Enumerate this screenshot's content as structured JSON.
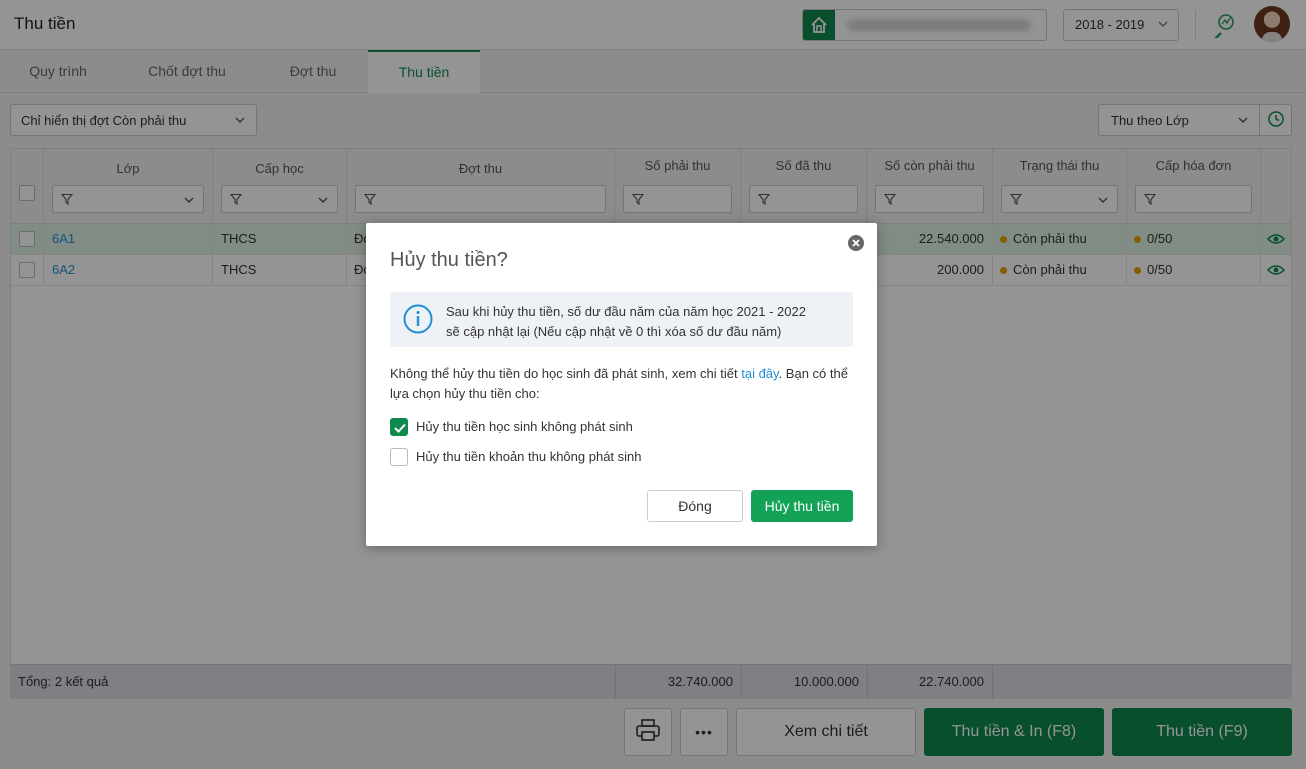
{
  "header": {
    "title": "Thu tiền",
    "school_name": "Trường THCS Hoàng Hoa Thám",
    "school_year": "2018 - 2019"
  },
  "tabs": [
    {
      "label": "Quy trình",
      "active": false
    },
    {
      "label": "Chốt đợt thu",
      "active": false
    },
    {
      "label": "Đợt thu",
      "active": false
    },
    {
      "label": "Thu tiền",
      "active": true
    }
  ],
  "toolbar": {
    "filter_value": "Chỉ hiển thị đợt Còn phải thu",
    "group_by_value": "Thu theo Lớp"
  },
  "table": {
    "columns": [
      "Lớp",
      "Cấp học",
      "Đợt thu",
      "Số phải thu",
      "Số đã thu",
      "Số còn phải thu",
      "Trạng thái thu",
      "Cấp hóa đơn"
    ],
    "rows": [
      {
        "class": "6A1",
        "level": "THCS",
        "batch": "Đợ",
        "due": "",
        "paid": "",
        "remaining": "22.540.000",
        "status": "Còn phải thu",
        "invoice": "0/50"
      },
      {
        "class": "6A2",
        "level": "THCS",
        "batch": "Đợ",
        "due": "",
        "paid": "",
        "remaining": "200.000",
        "status": "Còn phải thu",
        "invoice": "0/50"
      }
    ],
    "footer": {
      "summary": "Tổng: 2 kết quả",
      "total_due": "32.740.000",
      "total_paid": "10.000.000",
      "total_remaining": "22.740.000"
    }
  },
  "bottom": {
    "more_label": "•••",
    "details_label": "Xem chi tiết",
    "collect_print_label": "Thu tiền & In (F8)",
    "collect_label": "Thu tiền (F9)"
  },
  "dialog": {
    "title": "Hủy thu tiền?",
    "info_line1": "Sau khi hủy thu tiền, số dư đầu năm của năm học 2021 - 2022",
    "info_line2": "sẽ cập nhật lại (Nếu cập nhật về 0 thì xóa số dư đầu năm)",
    "message_before": "Không thể hủy thu tiền do học sinh đã phát sinh, xem chi tiết ",
    "message_link": "tại đây",
    "message_after": ". Bạn có thể lựa chọn hủy thu tiền cho:",
    "options": [
      {
        "label": "Hủy thu tiền học sinh không phát sinh",
        "checked": true
      },
      {
        "label": "Hủy thu tiền khoản thu không phát sinh",
        "checked": false
      }
    ],
    "close_label": "Đóng",
    "confirm_label": "Hủy thu tiền"
  },
  "colors": {
    "brand_green": "#0e8a4e",
    "button_green": "#12a155",
    "link_blue": "#1f8fd6",
    "status_dot": "#e4a000",
    "selected_row": "#dff1e3"
  }
}
